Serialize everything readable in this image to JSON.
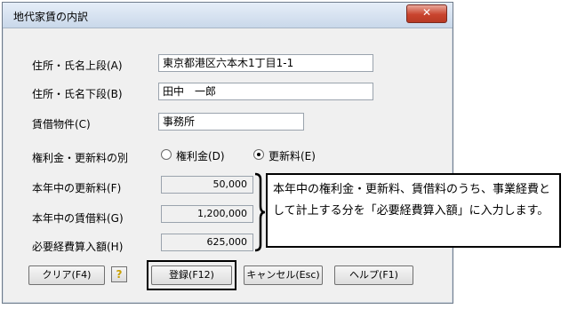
{
  "window": {
    "title": "地代家賃の内訳",
    "close_glyph": "✕"
  },
  "form": {
    "address_upper_label": "住所・氏名上段(A)",
    "address_upper_value": "東京都港区六本木1丁目1-1",
    "address_lower_label": "住所・氏名下段(B)",
    "address_lower_value": "田中　一郎",
    "property_label": "賃借物件(C)",
    "property_value": "事務所",
    "fee_type_label": "権利金・更新料の別",
    "fee_type_options": [
      {
        "label": "権利金(D)",
        "selected": false
      },
      {
        "label": "更新料(E)",
        "selected": true
      }
    ],
    "renewal_fee_label": "本年中の更新料(F)",
    "renewal_fee_value": "50,000",
    "rent_label": "本年中の賃借料(G)",
    "rent_value": "1,200,000",
    "expense_label": "必要経費算入額(H)",
    "expense_value": "625,000"
  },
  "buttons": {
    "clear": "クリア(F4)",
    "help_icon": "?",
    "register": "登録(F12)",
    "cancel": "キャンセル(Esc)",
    "help": "ヘルプ(F1)"
  },
  "callout": {
    "text": "本年中の権利金・更新料、賃借料のうち、事業経費として計上する分を「必要経費算入額」に入力します。"
  },
  "colors": {
    "window_bg": "#f0f0f0",
    "close_button": "#c9442e"
  }
}
